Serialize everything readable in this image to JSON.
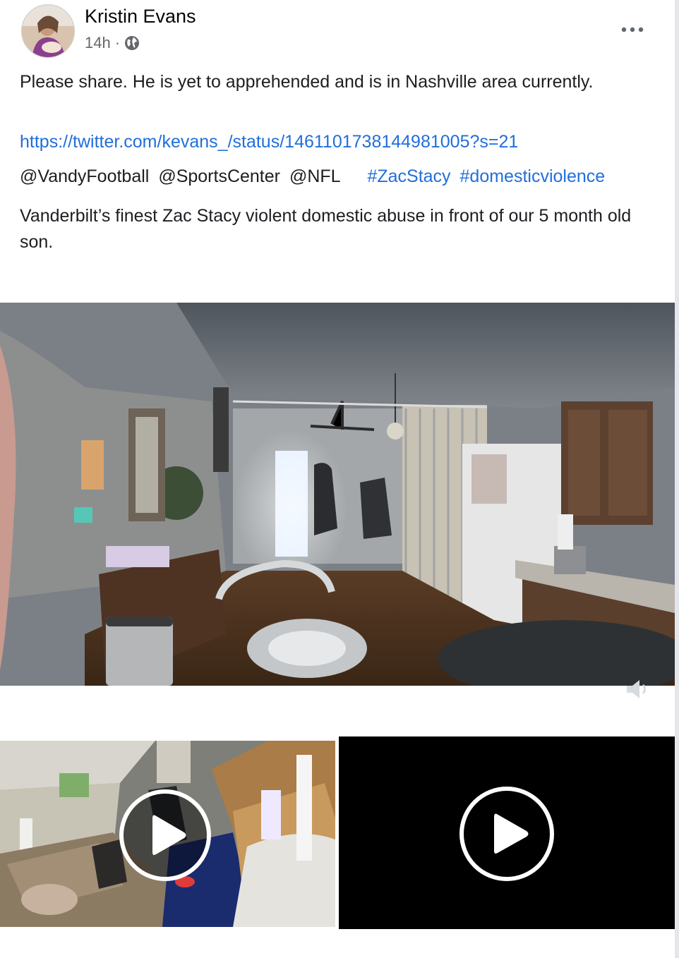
{
  "post": {
    "author": "Kristin Evans",
    "time": "14h",
    "separator": "·",
    "icons": {
      "avatar": "profile-photo",
      "privacy": "globe-icon",
      "menu": "more-options-icon",
      "volume": "volume-icon",
      "play": "play-icon"
    },
    "paragraph1": "Please share. He is yet to apprehended and is in Nashville area currently.",
    "link": "https://twitter.com/kevans_/status/1461101738144981005?s=21",
    "mentions": [
      "@VandyFootball",
      "@SportsCenter",
      "@NFL"
    ],
    "hashtags": [
      "#ZacStacy",
      "#domesticviolence"
    ],
    "paragraph2": "Vanderbilt’s finest Zac Stacy violent domestic abuse in front of our 5 month old son."
  },
  "colors": {
    "link": "#216fdb",
    "meta": "#65676b",
    "text": "#1c1e21"
  }
}
